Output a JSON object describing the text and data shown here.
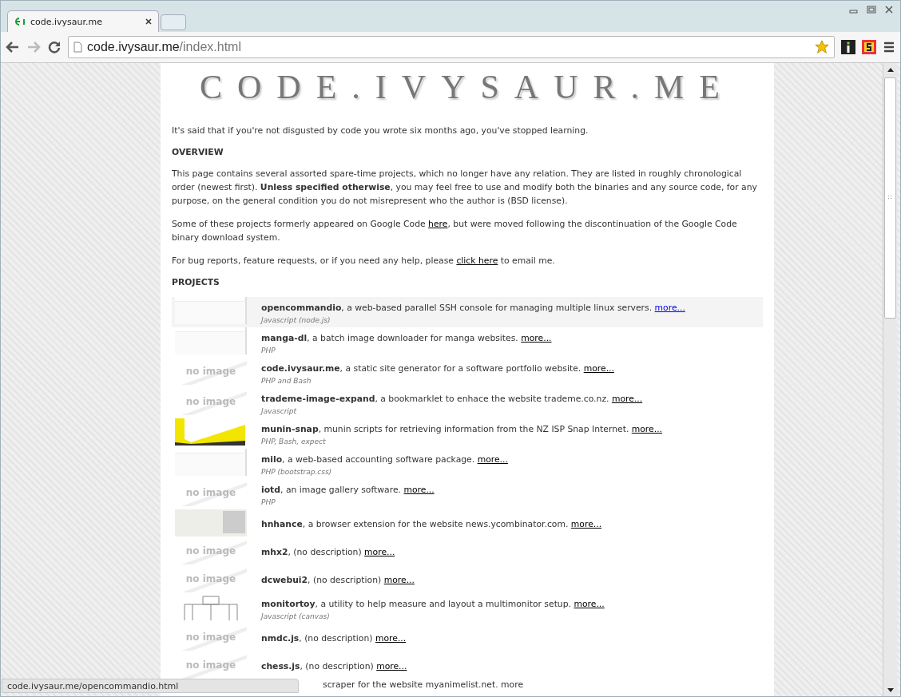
{
  "browser": {
    "tab_title": "code.ivysaur.me",
    "url_host": "code.ivysaur.me",
    "url_path": "/index.html"
  },
  "page": {
    "logo": "CODE.IVYSAUR.ME",
    "intro": "It's said that if you're not disgusted by code you wrote six months ago, you've stopped learning.",
    "overview_heading": "OVERVIEW",
    "paragraphs": [
      {
        "before": "This page contains several assorted spare-time projects, which no longer have any relation. They are listed in roughly chronological order (newest first). **Unless specified otherwise**, you may feel free to use and modify both the binaries and any source code, for any purpose, on the general condition you do not misrepresent who the author is (BSD license)."
      },
      {
        "before": "Some of these projects formerly appeared on Google Code ",
        "link": "here",
        "after": ", but were moved following the discontinuation of the Google Code binary download system."
      },
      {
        "before": "For bug reports, feature requests, or if you need any help, please ",
        "link": "click here",
        "after": " to email me."
      }
    ],
    "projects_heading": "PROJECTS",
    "projects": [
      {
        "name": "opencommandio",
        "description": ", a web-based parallel SSH console for managing multiple linux servers. ",
        "more": "more...",
        "tags": "Javascript (node.js)",
        "kind": "screenshot",
        "hovered": true
      },
      {
        "name": "manga-dl",
        "description": ", a batch image downloader for manga websites. ",
        "more": "more...",
        "tags": "PHP",
        "kind": "screenshot",
        "hovered": false
      },
      {
        "name": "code.ivysaur.me",
        "description": ", a static site generator for a software portfolio website. ",
        "more": "more...",
        "tags": "PHP and Bash",
        "kind": "none",
        "no_image": "no image",
        "hovered": false
      },
      {
        "name": "trademe-image-expand",
        "description": ", a bookmarklet to enhace the website trademe.co.nz. ",
        "more": "more...",
        "tags": "Javascript",
        "kind": "none",
        "no_image": "no image",
        "hovered": false
      },
      {
        "name": "munin-snap",
        "description": ", munin scripts for retrieving information from the NZ ISP Snap Internet. ",
        "more": "more...",
        "tags": "PHP, Bash, expect",
        "kind": "chart",
        "hovered": false
      },
      {
        "name": "milo",
        "description": ", a web-based accounting software package. ",
        "more": "more...",
        "tags": "PHP (bootstrap.css)",
        "kind": "screenshot",
        "hovered": false
      },
      {
        "name": "iotd",
        "description": ", an image gallery software. ",
        "more": "more...",
        "tags": "PHP",
        "kind": "none",
        "no_image": "no image",
        "hovered": false
      },
      {
        "name": "hnhance",
        "description": ", a browser extension for the website news.ycombinator.com. ",
        "more": "more...",
        "kind": "menu",
        "hovered": false
      },
      {
        "name": "mhx2",
        "description": ", (no description) ",
        "more": "more...",
        "kind": "none",
        "no_image": "no image",
        "hovered": false
      },
      {
        "name": "dcwebui2",
        "description": ", (no description) ",
        "more": "more...",
        "kind": "none",
        "no_image": "no image",
        "hovered": false
      },
      {
        "name": "monitortoy",
        "description": ", a utility to help measure and layout a multimonitor setup. ",
        "more": "more...",
        "tags": "Javascript (canvas)",
        "kind": "diagram",
        "hovered": false
      },
      {
        "name": "nmdc.js",
        "description": ", (no description) ",
        "more": "more...",
        "kind": "none",
        "no_image": "no image",
        "hovered": false
      },
      {
        "name": "chess.js",
        "description": ", (no description) ",
        "more": "more...",
        "kind": "none",
        "no_image": "no image",
        "hovered": false
      }
    ],
    "partial_row": "scraper for the website myanimelist.net. more"
  },
  "status_bar": "code.ivysaur.me/opencommandio.html"
}
